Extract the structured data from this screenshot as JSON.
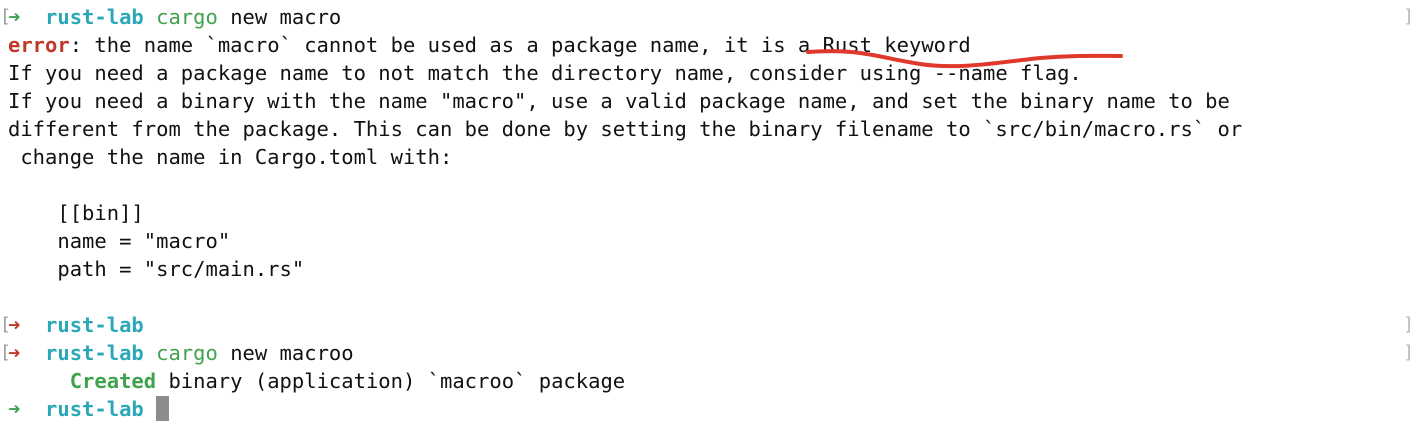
{
  "prompt": {
    "arrow": "➜",
    "directory": "rust-lab",
    "bracket_left": "[",
    "bracket_right": "]"
  },
  "lines": {
    "l1": {
      "cmd": "cargo",
      "args": "new macro"
    },
    "l2": {
      "label": "error",
      "rest": ": the name `macro` cannot be used as a package name, it is a Rust keyword"
    },
    "l3": "If you need a package name to not match the directory name, consider using --name flag.",
    "l4": "If you need a binary with the name \"macro\", use a valid package name, and set the binary name to be",
    "l5": "different from the package. This can be done by setting the binary filename to `src/bin/macro.rs` or",
    "l6": " change the name in Cargo.toml with:",
    "l8": "    [[bin]]",
    "l9": "    name = \"macro\"",
    "l10": "    path = \"src/main.rs\"",
    "l13": {
      "cmd": "cargo",
      "args": "new macroo"
    },
    "l14": {
      "label": "Created",
      "rest": " binary (application) `macroo` package"
    }
  },
  "colors": {
    "annotation_underline": "#e0382a",
    "prompt_ok": "#3fa34d",
    "prompt_err": "#c0392b",
    "directory": "#2aa8b8",
    "cursor": "#8c8c8c"
  }
}
